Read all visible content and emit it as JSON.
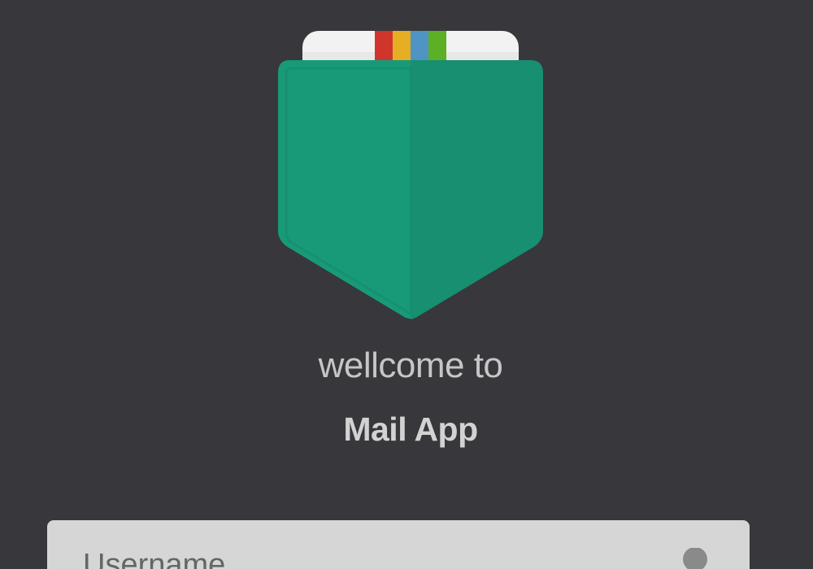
{
  "login": {
    "greeting": "wellcome to",
    "app_name": "Mail App",
    "username_placeholder": "Username"
  },
  "icons": {
    "logo": "mail-pocket-logo",
    "username": "user-icon"
  },
  "colors": {
    "background": "#37373c",
    "logo_green": "#189a78",
    "logo_green_dark": "#178f70",
    "stripe_red": "#d0352c",
    "stripe_yellow": "#e6ae25",
    "stripe_blue": "#4f94c5",
    "stripe_green": "#5cb025",
    "input_background": "#d6d6d6"
  }
}
